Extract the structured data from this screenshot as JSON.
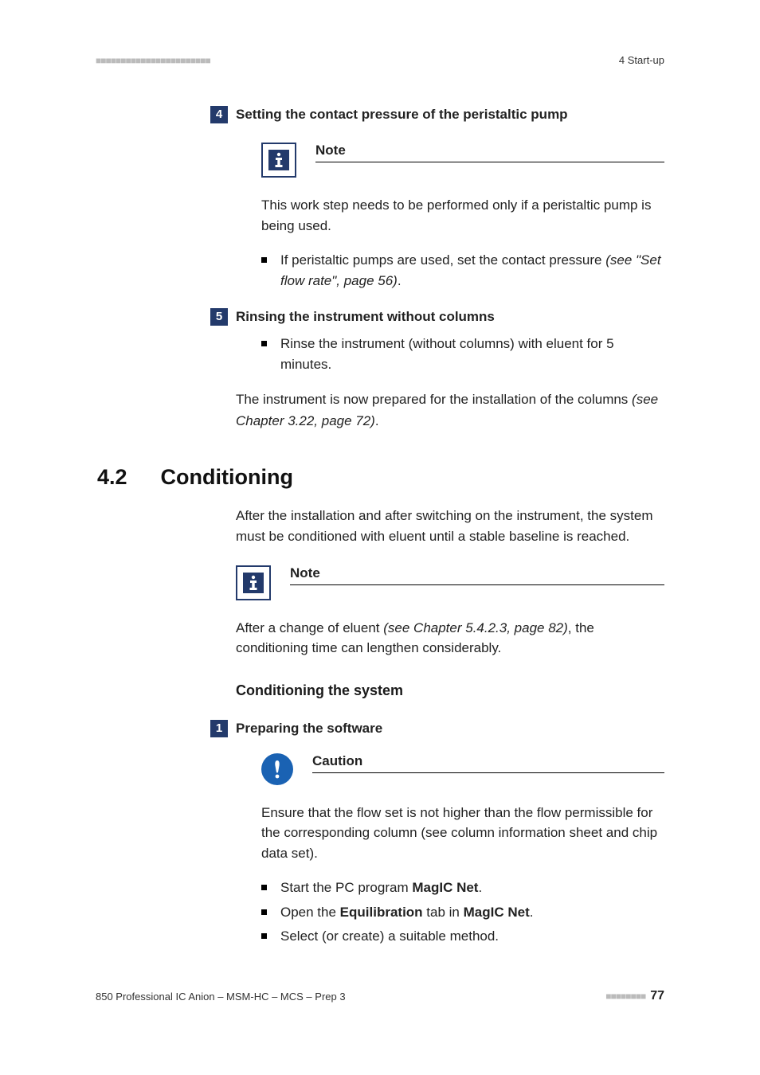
{
  "header": {
    "dashes": "■■■■■■■■■■■■■■■■■■■■■■■",
    "right": "4 Start-up"
  },
  "step4": {
    "num": "4",
    "title": "Setting the contact pressure of the peristaltic pump",
    "note_label": "Note",
    "note_body": "This work step needs to be performed only if a peristaltic pump is being used.",
    "bullet_lead": "If peristaltic pumps are used, set the contact pressure ",
    "bullet_ref": "(see \"Set flow rate\", page 56)",
    "bullet_tail": "."
  },
  "step5": {
    "num": "5",
    "title": "Rinsing the instrument without columns",
    "bullet": "Rinse the instrument (without columns) with eluent for 5 minutes."
  },
  "post_para_lead": "The instrument is now prepared for the installation of the columns ",
  "post_para_ref": "(see Chapter 3.22, page 72)",
  "post_para_tail": ".",
  "section": {
    "num": "4.2",
    "title": "Conditioning",
    "intro": "After the installation and after switching on the instrument, the system must be conditioned with eluent until a stable baseline is reached.",
    "note_label": "Note",
    "note_body_lead": "After a change of eluent ",
    "note_body_ref": "(see Chapter 5.4.2.3, page 82)",
    "note_body_tail": ", the conditioning time can lengthen considerably.",
    "subhead": "Conditioning the system"
  },
  "step1b": {
    "num": "1",
    "title": "Preparing the software",
    "caution_label": "Caution",
    "caution_body": "Ensure that the flow set is not higher than the flow permissible for the corresponding column (see column information sheet and chip data set).",
    "b1_lead": "Start the PC program ",
    "b1_bold": "MagIC Net",
    "b1_tail": ".",
    "b2_lead": "Open the ",
    "b2_bold1": "Equilibration",
    "b2_mid": " tab in ",
    "b2_bold2": "MagIC Net",
    "b2_tail": ".",
    "b3": "Select (or create) a suitable method."
  },
  "footer": {
    "left": "850 Professional IC Anion – MSM-HC – MCS – Prep 3",
    "dashes": "■■■■■■■■",
    "page": "77"
  }
}
